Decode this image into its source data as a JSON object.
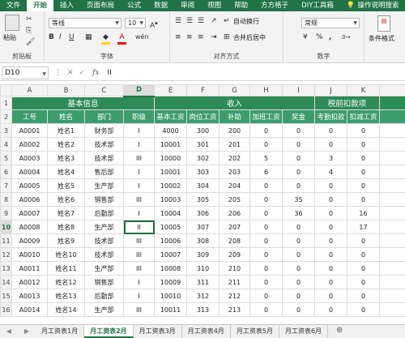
{
  "menubar": {
    "tabs": [
      "文件",
      "开始",
      "插入",
      "页面布局",
      "公式",
      "数据",
      "审阅",
      "视图",
      "帮助",
      "方方格子",
      "DIY工具箱"
    ],
    "active_index": 1,
    "help": "操作说明搜索"
  },
  "ribbon": {
    "clipboard": {
      "paste": "粘贴",
      "group": "剪贴板"
    },
    "font": {
      "name": "等线",
      "size": "10",
      "bold": "B",
      "italic": "I",
      "underline": "U",
      "wen": "wén",
      "group": "字体"
    },
    "align": {
      "wrap": "自动换行",
      "merge": "合并后居中",
      "group": "对齐方式"
    },
    "number": {
      "format": "常规",
      "percent": "%",
      "comma": ",",
      "group": "数字"
    },
    "styles": {
      "cond": "条件格式"
    }
  },
  "formula_bar": {
    "namebox": "D10",
    "fx": "fx",
    "value": "II"
  },
  "columns": [
    "A",
    "B",
    "C",
    "D",
    "E",
    "F",
    "G",
    "H",
    "I",
    "J",
    "K"
  ],
  "active_column": "D",
  "active_row": 10,
  "active_cell_value": "II",
  "header1": {
    "basic": "基本信息",
    "income": "收入",
    "deduct": "税前扣款项"
  },
  "header2": [
    "工号",
    "姓名",
    "部门",
    "职级",
    "基本工资",
    "岗位工资",
    "补助",
    "加班工资",
    "奖金",
    "考勤扣款",
    "扣减工资"
  ],
  "rows": [
    [
      "A0001",
      "姓名1",
      "财务部",
      "I",
      "4000",
      "300",
      "200",
      "0",
      "0",
      "0",
      "0"
    ],
    [
      "A0002",
      "姓名2",
      "技术部",
      "I",
      "10001",
      "301",
      "201",
      "0",
      "0",
      "0",
      "0"
    ],
    [
      "A0003",
      "姓名3",
      "技术部",
      "III",
      "10000",
      "302",
      "202",
      "5",
      "0",
      "3",
      "0"
    ],
    [
      "A0004",
      "姓名4",
      "售后部",
      "I",
      "10001",
      "303",
      "203",
      "6",
      "0",
      "4",
      "0"
    ],
    [
      "A0005",
      "姓名5",
      "生产部",
      "I",
      "10002",
      "304",
      "204",
      "0",
      "0",
      "0",
      "0"
    ],
    [
      "A0006",
      "姓名6",
      "销售部",
      "III",
      "10003",
      "305",
      "205",
      "0",
      "35",
      "0",
      "0"
    ],
    [
      "A0007",
      "姓名7",
      "后勤部",
      "I",
      "10004",
      "306",
      "206",
      "0",
      "36",
      "0",
      "16"
    ],
    [
      "A0008",
      "姓名8",
      "生产部",
      "II",
      "10005",
      "307",
      "207",
      "0",
      "0",
      "0",
      "17"
    ],
    [
      "A0009",
      "姓名9",
      "技术部",
      "III",
      "10006",
      "308",
      "208",
      "0",
      "0",
      "0",
      "0"
    ],
    [
      "A0010",
      "姓名10",
      "技术部",
      "III",
      "10007",
      "309",
      "209",
      "0",
      "0",
      "0",
      "0"
    ],
    [
      "A0011",
      "姓名11",
      "生产部",
      "III",
      "10008",
      "310",
      "210",
      "0",
      "0",
      "0",
      "0"
    ],
    [
      "A0012",
      "姓名12",
      "销售部",
      "I",
      "10009",
      "311",
      "211",
      "0",
      "0",
      "0",
      "0"
    ],
    [
      "A0013",
      "姓名13",
      "后勤部",
      "I",
      "10010",
      "312",
      "212",
      "0",
      "0",
      "0",
      "0"
    ],
    [
      "A0014",
      "姓名14",
      "生产部",
      "III",
      "10011",
      "313",
      "213",
      "0",
      "0",
      "0",
      "0"
    ]
  ],
  "row_numbers": [
    "1",
    "2",
    "3",
    "4",
    "5",
    "6",
    "7",
    "8",
    "9",
    "10",
    "11",
    "12",
    "13",
    "14",
    "15",
    "16"
  ],
  "sheet_tabs": [
    "月工资表1月",
    "月工资表2月",
    "月工资表3月",
    "月工资表4月",
    "月工资表5月",
    "月工资表6月"
  ],
  "active_sheet": 1,
  "colors": {
    "green": "#217346",
    "header_green": "#2e8b57"
  }
}
